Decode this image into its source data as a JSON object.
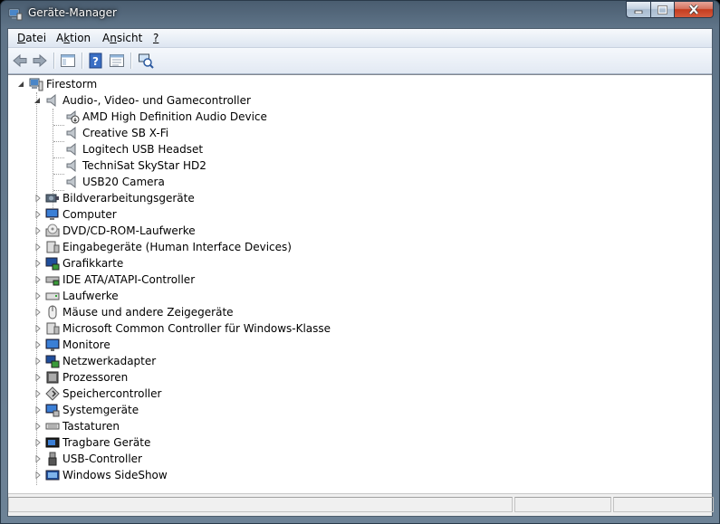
{
  "window": {
    "title": "Geräte-Manager",
    "colors": {
      "selection": "#3399ff",
      "titlebar": "#566b80",
      "close_button": "#c43c1f"
    }
  },
  "menu": [
    {
      "label": "Datei",
      "accel": "D",
      "rest": "atei"
    },
    {
      "label": "Aktion",
      "pre": "A",
      "accel": "k",
      "rest": "tion"
    },
    {
      "label": "Ansicht",
      "pre": "A",
      "accel": "n",
      "rest": "sicht"
    },
    {
      "label": "?",
      "accel": "?",
      "rest": ""
    }
  ],
  "toolbar": [
    "back-arrow-icon",
    "forward-arrow-icon",
    "console-tree-icon",
    "help-icon",
    "properties-icon",
    "scan-hardware-icon"
  ],
  "tree": {
    "root": "Firestorm",
    "expanded_category": {
      "label": "Audio-, Video- und Gamecontroller",
      "devices": [
        "AMD High Definition Audio Device",
        "Creative SB X-Fi",
        "Logitech USB Headset",
        "TechniSat SkyStar HD2",
        "USB20 Camera"
      ]
    },
    "categories": [
      {
        "label": "Bildverarbeitungsgeräte",
        "icon": "camera-icon"
      },
      {
        "label": "Computer",
        "icon": "computer-icon"
      },
      {
        "label": "DVD/CD-ROM-Laufwerke",
        "icon": "dvd-drive-icon"
      },
      {
        "label": "Eingabegeräte (Human Interface Devices)",
        "icon": "hid-icon"
      },
      {
        "label": "Grafikkarte",
        "icon": "display-adapter-icon"
      },
      {
        "label": "IDE ATA/ATAPI-Controller",
        "icon": "ide-controller-icon"
      },
      {
        "label": "Laufwerke",
        "icon": "disk-drive-icon"
      },
      {
        "label": "Mäuse und andere Zeigegeräte",
        "icon": "mouse-icon"
      },
      {
        "label": "Microsoft Common Controller für Windows-Klasse",
        "icon": "controller-icon"
      },
      {
        "label": "Monitore",
        "icon": "monitor-icon"
      },
      {
        "label": "Netzwerkadapter",
        "icon": "network-adapter-icon"
      },
      {
        "label": "Prozessoren",
        "icon": "processor-icon"
      },
      {
        "label": "Speichercontroller",
        "icon": "storage-controller-icon"
      },
      {
        "label": "Systemgeräte",
        "icon": "system-devices-icon"
      },
      {
        "label": "Tastaturen",
        "icon": "keyboard-icon"
      },
      {
        "label": "Tragbare Geräte",
        "icon": "portable-device-icon"
      },
      {
        "label": "USB-Controller",
        "icon": "usb-icon"
      },
      {
        "label": "Windows SideShow",
        "icon": "sideshow-icon"
      }
    ]
  }
}
